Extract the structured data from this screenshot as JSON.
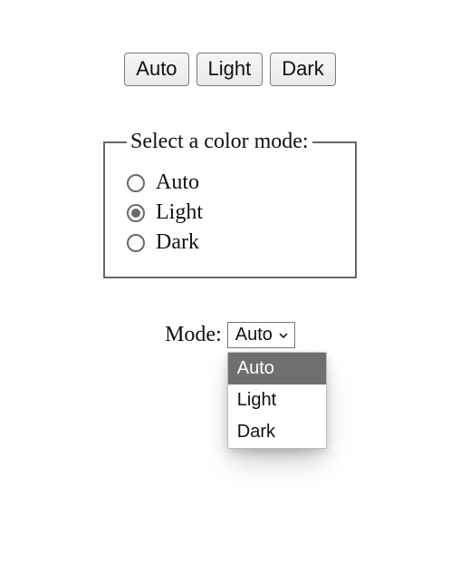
{
  "buttons": {
    "auto": "Auto",
    "light": "Light",
    "dark": "Dark"
  },
  "fieldset": {
    "legend": "Select a color mode:",
    "options": {
      "auto": {
        "label": "Auto",
        "selected": false
      },
      "light": {
        "label": "Light",
        "selected": true
      },
      "dark": {
        "label": "Dark",
        "selected": false
      }
    }
  },
  "select": {
    "label": "Mode:",
    "value": "Auto",
    "options": {
      "auto": {
        "label": "Auto",
        "highlighted": true
      },
      "light": {
        "label": "Light",
        "highlighted": false
      },
      "dark": {
        "label": "Dark",
        "highlighted": false
      }
    }
  }
}
